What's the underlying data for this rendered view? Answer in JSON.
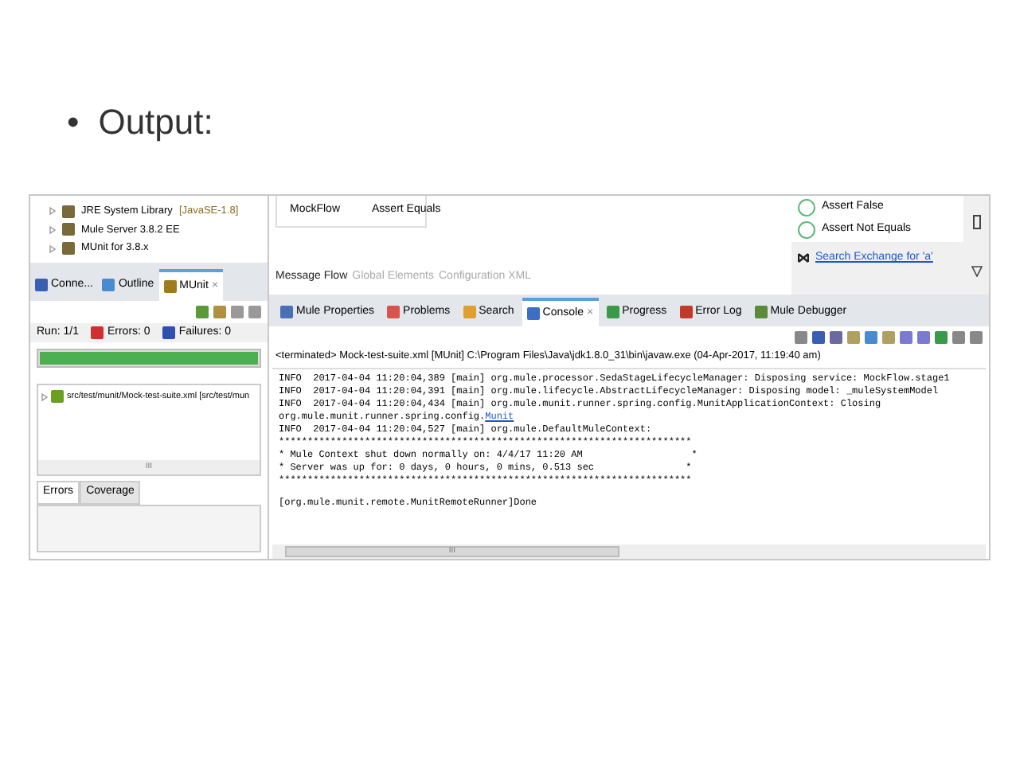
{
  "slide": {
    "bullet": "•",
    "heading": "Output:"
  },
  "project_tree": [
    {
      "label": "JRE System Library",
      "suffix": "[JavaSE-1.8]"
    },
    {
      "label": "Mule Server 3.8.2 EE"
    },
    {
      "label": "MUnit for 3.8.x"
    }
  ],
  "left_tabs": [
    {
      "label": "Conne...",
      "selected": false
    },
    {
      "label": "Outline",
      "selected": false
    },
    {
      "label": "MUnit",
      "selected": true,
      "close": "×"
    }
  ],
  "munit": {
    "run": "Run: 1/1",
    "errors": "Errors: 0",
    "failures": "Failures: 0",
    "level": 1,
    "passed": true,
    "tree_item": "src/test/munit/Mock-test-suite.xml [src/test/mun",
    "scroll_mark": "III"
  },
  "bottom_tabs": [
    {
      "label": "Errors",
      "selected": true
    },
    {
      "label": "Coverage",
      "selected": false
    }
  ],
  "canvas": {
    "flow_items": [
      "MockFlow",
      "Assert Equals"
    ],
    "editor_tabs": [
      {
        "label": "Message Flow",
        "selected": true
      },
      {
        "label": "Global Elements",
        "selected": false
      },
      {
        "label": "Configuration XML",
        "selected": false
      }
    ]
  },
  "palette": {
    "items": [
      "Assert False",
      "Assert Not Equals"
    ],
    "link": "Search Exchange for 'a'"
  },
  "console_tabs": [
    {
      "label": "Mule Properties",
      "selected": false
    },
    {
      "label": "Problems",
      "selected": false
    },
    {
      "label": "Search",
      "selected": false
    },
    {
      "label": "Console",
      "selected": true,
      "close": "×"
    },
    {
      "label": "Progress",
      "selected": false
    },
    {
      "label": "Error Log",
      "selected": false
    },
    {
      "label": "Mule Debugger",
      "selected": false
    }
  ],
  "console": {
    "status": "<terminated> Mock-test-suite.xml [MUnit] C:\\Program Files\\Java\\jdk1.8.0_31\\bin\\javaw.exe (04-Apr-2017, 11:19:40 am)",
    "lines": [
      {
        "text": "INFO  2017-04-04 11:20:04,389 [main] org.mule.processor.SedaStageLifecycleManager: Disposing service: MockFlow.stage1"
      },
      {
        "text": "INFO  2017-04-04 11:20:04,391 [main] org.mule.lifecycle.AbstractLifecycleManager: Disposing model: _muleSystemModel"
      },
      {
        "text": "INFO  2017-04-04 11:20:04,434 [main] org.mule.munit.runner.spring.config.MunitApplicationContext: Closing org.mule.munit.runner.spring.config.",
        "link": "Munit"
      },
      {
        "text": "INFO  2017-04-04 11:20:04,527 [main] org.mule.DefaultMuleContext:"
      },
      {
        "text": "************************************************************************"
      },
      {
        "text": "* Mule Context shut down normally on: 4/4/17 11:20 AM                   *"
      },
      {
        "text": "* Server was up for: 0 days, 0 hours, 0 mins, 0.513 sec                *"
      },
      {
        "text": "************************************************************************"
      },
      {
        "text": "[org.mule.munit.remote.MunitRemoteRunner]Done"
      }
    ],
    "scroll_mark": "III"
  }
}
